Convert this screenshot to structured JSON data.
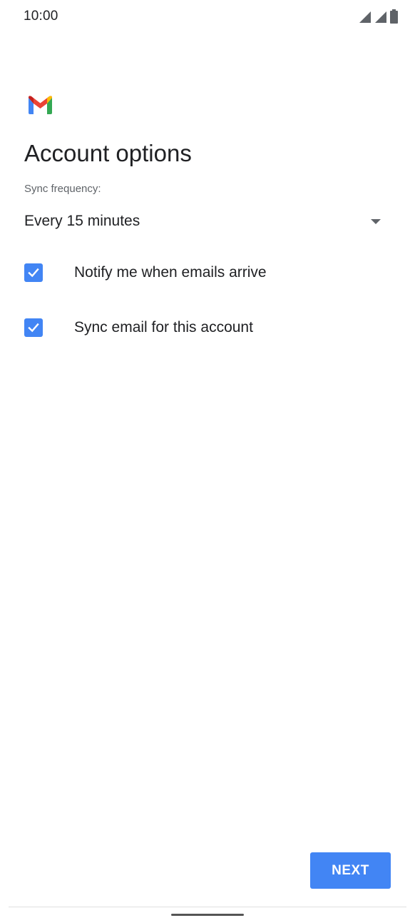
{
  "status_bar": {
    "time": "10:00",
    "icons": [
      "signal-icon",
      "signal-icon",
      "battery-icon"
    ]
  },
  "app": {
    "logo_icon": "gmail-logo-icon"
  },
  "page": {
    "title": "Account options"
  },
  "sync": {
    "label": "Sync frequency:",
    "selected_value": "Every 15 minutes"
  },
  "options": [
    {
      "label": "Notify me when emails arrive",
      "checked": true
    },
    {
      "label": "Sync email for this account",
      "checked": true
    }
  ],
  "actions": {
    "next_label": "NEXT"
  },
  "colors": {
    "accent": "#4285f4",
    "text": "#202124",
    "secondary_text": "#5f6368"
  }
}
